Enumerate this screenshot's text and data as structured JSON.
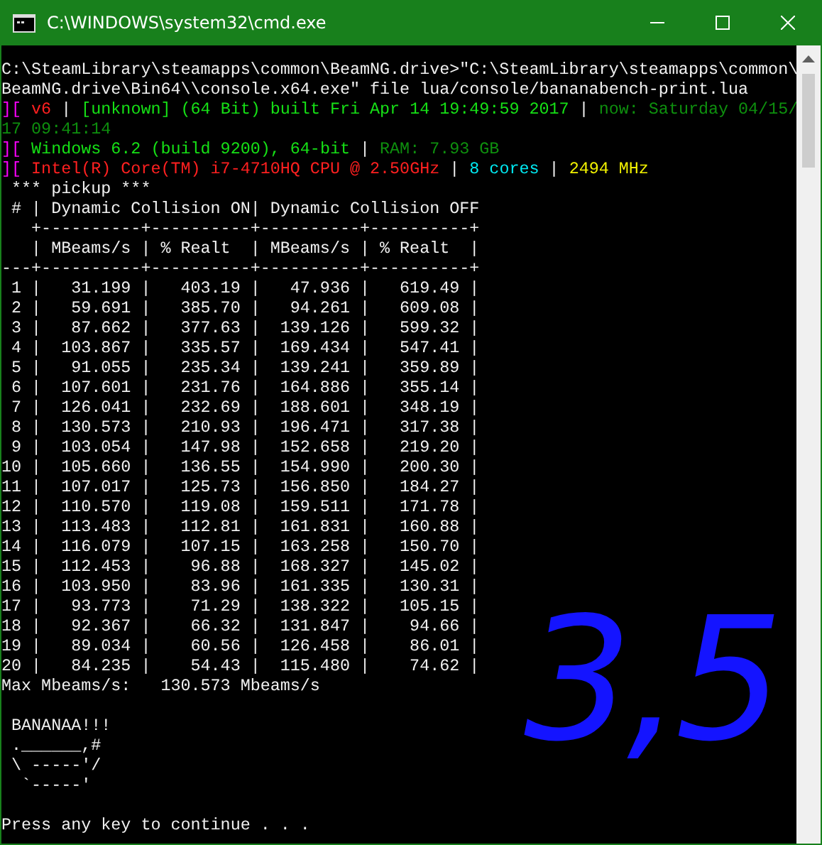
{
  "window": {
    "title": "C:\\WINDOWS\\system32\\cmd.exe"
  },
  "console": {
    "blocks": [
      {
        "lines": [
          [
            {
              "text": "C:\\SteamLibrary\\steamapps\\common\\BeamNG.drive>\"C:\\SteamLibrary\\steamapps\\common\\",
              "color": "#f0f0f0"
            }
          ],
          [
            {
              "text": "BeamNG.drive\\Bin64\\\\console.x64.exe\" file lua/console/bananabench-print.lua",
              "color": "#f0f0f0"
            }
          ],
          [
            {
              "text": "][",
              "color": "#ff00ff"
            },
            {
              "text": " v6",
              "color": "#ff2020"
            },
            {
              "text": " | ",
              "color": "#f0f0f0"
            },
            {
              "text": "[unknown] (64 Bit) built Fri Apr 14 19:49:59 2017",
              "color": "#16e016"
            },
            {
              "text": " | ",
              "color": "#f0f0f0"
            },
            {
              "text": "now: Saturday 04/15/",
              "color": "#0e8f0e"
            }
          ],
          [
            {
              "text": "17 09:41:14",
              "color": "#0e8f0e"
            }
          ],
          [
            {
              "text": "][",
              "color": "#ff00ff"
            },
            {
              "text": " Windows 6.2 (build 9200), 64-bit",
              "color": "#16e016"
            },
            {
              "text": " | ",
              "color": "#f0f0f0"
            },
            {
              "text": "RAM: 7.93 GB",
              "color": "#0e8f0e"
            }
          ],
          [
            {
              "text": "][",
              "color": "#ff00ff"
            },
            {
              "text": " Intel(R) Core(TM) i7-4710HQ CPU @ 2.50GHz",
              "color": "#ff2020"
            },
            {
              "text": " | ",
              "color": "#f0f0f0"
            },
            {
              "text": "8 cores",
              "color": "#00e8f0"
            },
            {
              "text": " | ",
              "color": "#f0f0f0"
            },
            {
              "text": "2494 MHz",
              "color": "#f0f000"
            }
          ],
          [
            {
              "text": " *** pickup ***",
              "color": "#f0f0f0"
            }
          ],
          [
            {
              "text": " # | Dynamic Collision ON| Dynamic Collision OFF",
              "color": "#f0f0f0"
            }
          ],
          [
            {
              "text": "   +----------+----------+----------+----------+",
              "color": "#f0f0f0"
            }
          ],
          [
            {
              "text": "   | MBeams/s | % Realt  | MBeams/s | % Realt  |",
              "color": "#f0f0f0"
            }
          ],
          [
            {
              "text": "---+----------+----------+----------+----------+",
              "color": "#f0f0f0"
            }
          ],
          [
            {
              "text": " 1 |   31.199 |   403.19 |   47.936 |   619.49 |",
              "color": "#f0f0f0"
            }
          ],
          [
            {
              "text": " 2 |   59.691 |   385.70 |   94.261 |   609.08 |",
              "color": "#f0f0f0"
            }
          ],
          [
            {
              "text": " 3 |   87.662 |   377.63 |  139.126 |   599.32 |",
              "color": "#f0f0f0"
            }
          ],
          [
            {
              "text": " 4 |  103.867 |   335.57 |  169.434 |   547.41 |",
              "color": "#f0f0f0"
            }
          ],
          [
            {
              "text": " 5 |   91.055 |   235.34 |  139.241 |   359.89 |",
              "color": "#f0f0f0"
            }
          ],
          [
            {
              "text": " 6 |  107.601 |   231.76 |  164.886 |   355.14 |",
              "color": "#f0f0f0"
            }
          ],
          [
            {
              "text": " 7 |  126.041 |   232.69 |  188.601 |   348.19 |",
              "color": "#f0f0f0"
            }
          ],
          [
            {
              "text": " 8 |  130.573 |   210.93 |  196.471 |   317.38 |",
              "color": "#f0f0f0"
            }
          ],
          [
            {
              "text": " 9 |  103.054 |   147.98 |  152.658 |   219.20 |",
              "color": "#f0f0f0"
            }
          ],
          [
            {
              "text": "10 |  105.660 |   136.55 |  154.990 |   200.30 |",
              "color": "#f0f0f0"
            }
          ],
          [
            {
              "text": "11 |  107.017 |   125.73 |  156.850 |   184.27 |",
              "color": "#f0f0f0"
            }
          ],
          [
            {
              "text": "12 |  110.570 |   119.08 |  159.511 |   171.78 |",
              "color": "#f0f0f0"
            }
          ],
          [
            {
              "text": "13 |  113.483 |   112.81 |  161.831 |   160.88 |",
              "color": "#f0f0f0"
            }
          ],
          [
            {
              "text": "14 |  116.079 |   107.15 |  163.258 |   150.70 |",
              "color": "#f0f0f0"
            }
          ],
          [
            {
              "text": "15 |  112.453 |    96.88 |  168.327 |   145.02 |",
              "color": "#f0f0f0"
            }
          ],
          [
            {
              "text": "16 |  103.950 |    83.96 |  161.335 |   130.31 |",
              "color": "#f0f0f0"
            }
          ],
          [
            {
              "text": "17 |   93.773 |    71.29 |  138.322 |   105.15 |",
              "color": "#f0f0f0"
            }
          ],
          [
            {
              "text": "18 |   92.367 |    66.32 |  131.847 |    94.66 |",
              "color": "#f0f0f0"
            }
          ],
          [
            {
              "text": "19 |   89.034 |    60.56 |  126.458 |    86.01 |",
              "color": "#f0f0f0"
            }
          ],
          [
            {
              "text": "20 |   84.235 |    54.43 |  115.480 |    74.62 |",
              "color": "#f0f0f0"
            }
          ],
          [
            {
              "text": "Max Mbeams/s:   130.573 Mbeams/s",
              "color": "#f0f0f0"
            }
          ]
        ]
      },
      {
        "lines": [
          [
            {
              "text": " BANANAA!!!",
              "color": "#f0f0f0"
            }
          ],
          [
            {
              "text": " .______,#",
              "color": "#f0f0f0"
            }
          ],
          [
            {
              "text": " \\ -----'/",
              "color": "#f0f0f0"
            }
          ],
          [
            {
              "text": "  `-----'",
              "color": "#f0f0f0"
            }
          ]
        ]
      },
      {
        "lines": [
          [
            {
              "text": "Press any key to continue . . .",
              "color": "#f0f0f0"
            }
          ]
        ]
      }
    ]
  },
  "annotation": "3,5"
}
